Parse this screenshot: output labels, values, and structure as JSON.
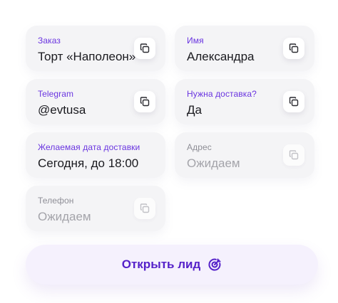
{
  "fields": [
    {
      "label": "Заказ",
      "value": "Торт «Наполеон»"
    },
    {
      "label": "Имя",
      "value": "Александра"
    },
    {
      "label": "Telegram",
      "value": "@evtusa"
    },
    {
      "label": "Нужна доставка?",
      "value": "Да"
    },
    {
      "label": "Желаемая дата доставки",
      "value": "Сегодня, до 18:00"
    },
    {
      "label": "Адрес",
      "value": "Ожидаем"
    },
    {
      "label": "Телефон",
      "value": "Ожидаем"
    }
  ],
  "open_button": {
    "label": "Открыть лид",
    "icon": "target-icon"
  },
  "copy_icon": "copy-icon",
  "colors": {
    "accent": "#6a35e0",
    "button_text": "#5521c9",
    "pending_text": "#a4a4aa"
  }
}
